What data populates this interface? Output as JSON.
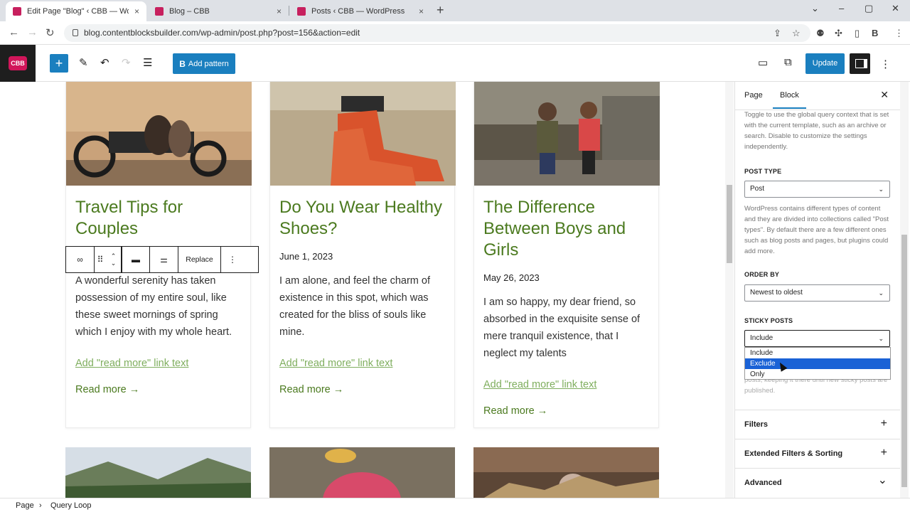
{
  "browser": {
    "tabs": [
      {
        "title": "Edit Page \"Blog\" ‹ CBB — WordP…",
        "close": "×"
      },
      {
        "title": "Blog – CBB",
        "close": "×"
      },
      {
        "title": "Posts ‹ CBB — WordPress",
        "close": "×"
      }
    ],
    "new_tab": "+",
    "url": "blog.contentblocksbuilder.com/wp-admin/post.php?post=156&action=edit"
  },
  "toolbar": {
    "logo": "CBB",
    "add_pattern_label": "Add pattern",
    "update_label": "Update"
  },
  "cards": [
    {
      "title": "Travel Tips for Couples",
      "date": "",
      "excerpt": "A wonderful serenity has taken possession of my entire soul, like these sweet mornings of spring which I enjoy with my whole heart.",
      "read_more_link": "Add \"read more\" link text",
      "read_more": "Read more →"
    },
    {
      "title": "Do You Wear Healthy Shoes?",
      "date": "June 1, 2023",
      "excerpt": "I am alone, and feel the charm of existence in this spot, which was created for the bliss of souls like mine.",
      "read_more_link": "Add \"read more\" link text",
      "read_more": "Read more →"
    },
    {
      "title": "The Difference Between Boys and Girls",
      "date": "May 26, 2023",
      "excerpt": "I am so happy, my dear friend, so absorbed in the exquisite sense of mere tranquil existence, that I neglect my talents",
      "read_more_link": "Add \"read more\" link text",
      "read_more": "Read more →"
    }
  ],
  "block_toolbar": {
    "replace_label": "Replace"
  },
  "sidebar": {
    "tab_page": "Page",
    "tab_block": "Block",
    "close": "✕",
    "query_help": "Toggle to use the global query context that is set with the current template, such as an archive or search. Disable to customize the settings independently.",
    "post_type_label": "POST TYPE",
    "post_type_value": "Post",
    "post_type_help": "WordPress contains different types of content and they are divided into collections called \"Post types\". By default there are a few different ones such as blog posts and pages, but plugins could add more.",
    "order_by_label": "ORDER BY",
    "order_by_value": "Newest to oldest",
    "sticky_label": "STICKY POSTS",
    "sticky_value": "Include",
    "sticky_options": [
      "Include",
      "Exclude",
      "Only"
    ],
    "sticky_help": "posts, keeping it there until new sticky posts are published.",
    "panels": [
      {
        "label": "Filters",
        "icon": "+"
      },
      {
        "label": "Extended Filters & Sorting",
        "icon": "+"
      },
      {
        "label": "Advanced",
        "icon": "⌄"
      }
    ]
  },
  "breadcrumb": {
    "root": "Page",
    "sep": "›",
    "current": "Query Loop"
  },
  "colors": {
    "accent": "#1a7fbf",
    "title_green": "#4b7a1f",
    "brand": "#d1165a"
  }
}
